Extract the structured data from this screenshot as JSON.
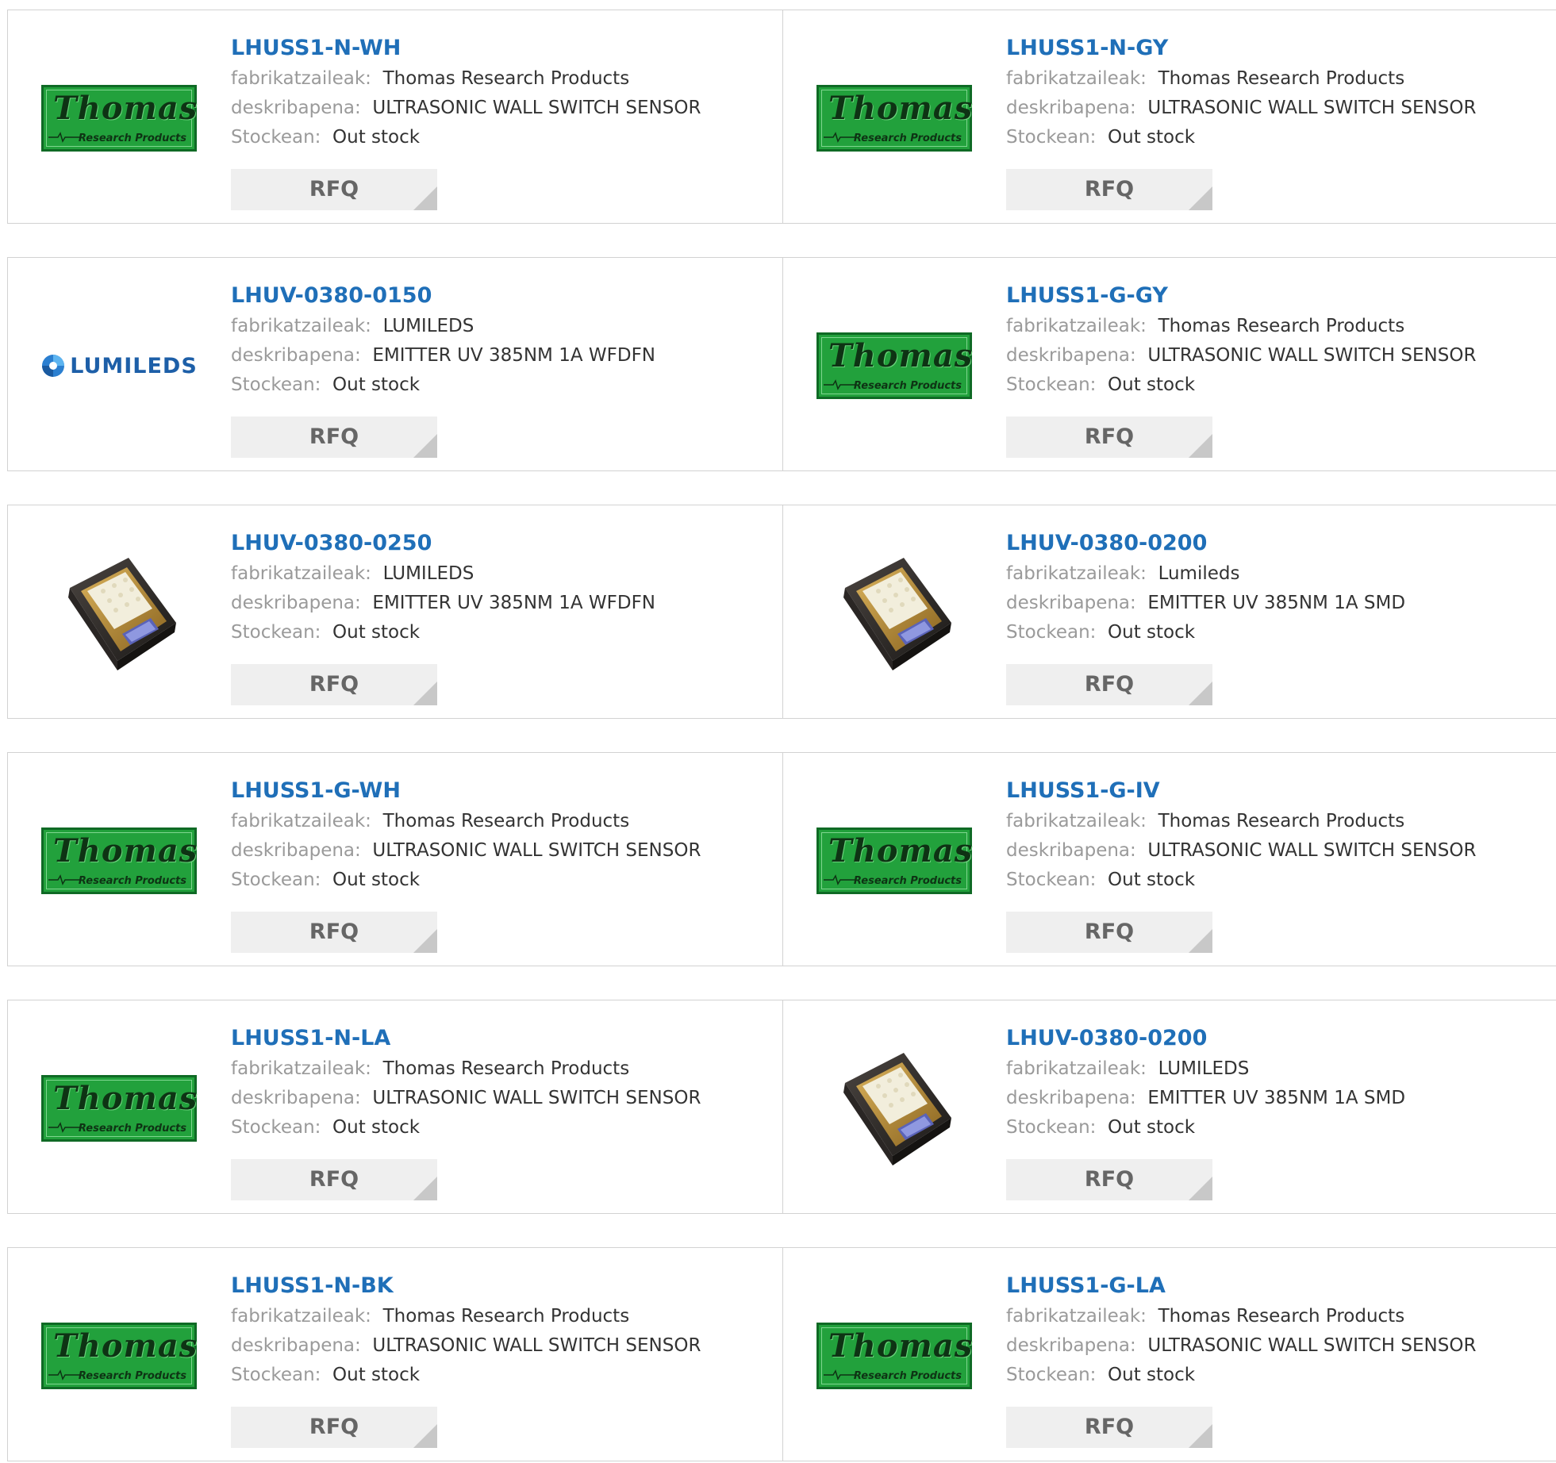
{
  "labels": {
    "manufacturer": "fabrikatzaileak:",
    "description": "deskribapena:",
    "stock": "Stockean:",
    "rfq": "RFQ"
  },
  "logos": {
    "thomas_name": "Thomas",
    "thomas_sub": "Research Products",
    "lumileds_text": "LUMILEDS"
  },
  "colors": {
    "part_link": "#1f6fb8",
    "label_gray": "#9a9a9a",
    "value_dark": "#333333",
    "rfq_bg": "#efefef",
    "thomas_green": "#22a13c",
    "lumileds_blue": "#1d5fa8"
  },
  "products": [
    {
      "part": "LHUSS1-N-WH",
      "image": "thomas-logo",
      "manufacturer": "Thomas Research Products",
      "description": "ULTRASONIC WALL SWITCH SENSOR",
      "stock": "Out stock"
    },
    {
      "part": "LHUSS1-N-GY",
      "image": "thomas-logo",
      "manufacturer": "Thomas Research Products",
      "description": "ULTRASONIC WALL SWITCH SENSOR",
      "stock": "Out stock"
    },
    {
      "part": "LHUV-0380-0150",
      "image": "lumileds-logo",
      "manufacturer": "LUMILEDS",
      "description": "EMITTER UV 385NM 1A WFDFN",
      "stock": "Out stock"
    },
    {
      "part": "LHUSS1-G-GY",
      "image": "thomas-logo",
      "manufacturer": "Thomas Research Products",
      "description": "ULTRASONIC WALL SWITCH SENSOR",
      "stock": "Out stock"
    },
    {
      "part": "LHUV-0380-0250",
      "image": "led-chip-photo",
      "manufacturer": "LUMILEDS",
      "description": "EMITTER UV 385NM 1A WFDFN",
      "stock": "Out stock"
    },
    {
      "part": "LHUV-0380-0200",
      "image": "led-chip-photo",
      "manufacturer": "Lumileds",
      "description": "EMITTER UV 385NM 1A SMD",
      "stock": "Out stock"
    },
    {
      "part": "LHUSS1-G-WH",
      "image": "thomas-logo",
      "manufacturer": "Thomas Research Products",
      "description": "ULTRASONIC WALL SWITCH SENSOR",
      "stock": "Out stock"
    },
    {
      "part": "LHUSS1-G-IV",
      "image": "thomas-logo",
      "manufacturer": "Thomas Research Products",
      "description": "ULTRASONIC WALL SWITCH SENSOR",
      "stock": "Out stock"
    },
    {
      "part": "LHUSS1-N-LA",
      "image": "thomas-logo",
      "manufacturer": "Thomas Research Products",
      "description": "ULTRASONIC WALL SWITCH SENSOR",
      "stock": "Out stock"
    },
    {
      "part": "LHUV-0380-0200",
      "image": "led-chip-photo",
      "manufacturer": "LUMILEDS",
      "description": "EMITTER UV 385NM 1A SMD",
      "stock": "Out stock"
    },
    {
      "part": "LHUSS1-N-BK",
      "image": "thomas-logo",
      "manufacturer": "Thomas Research Products",
      "description": "ULTRASONIC WALL SWITCH SENSOR",
      "stock": "Out stock"
    },
    {
      "part": "LHUSS1-G-LA",
      "image": "thomas-logo",
      "manufacturer": "Thomas Research Products",
      "description": "ULTRASONIC WALL SWITCH SENSOR",
      "stock": "Out stock"
    }
  ]
}
